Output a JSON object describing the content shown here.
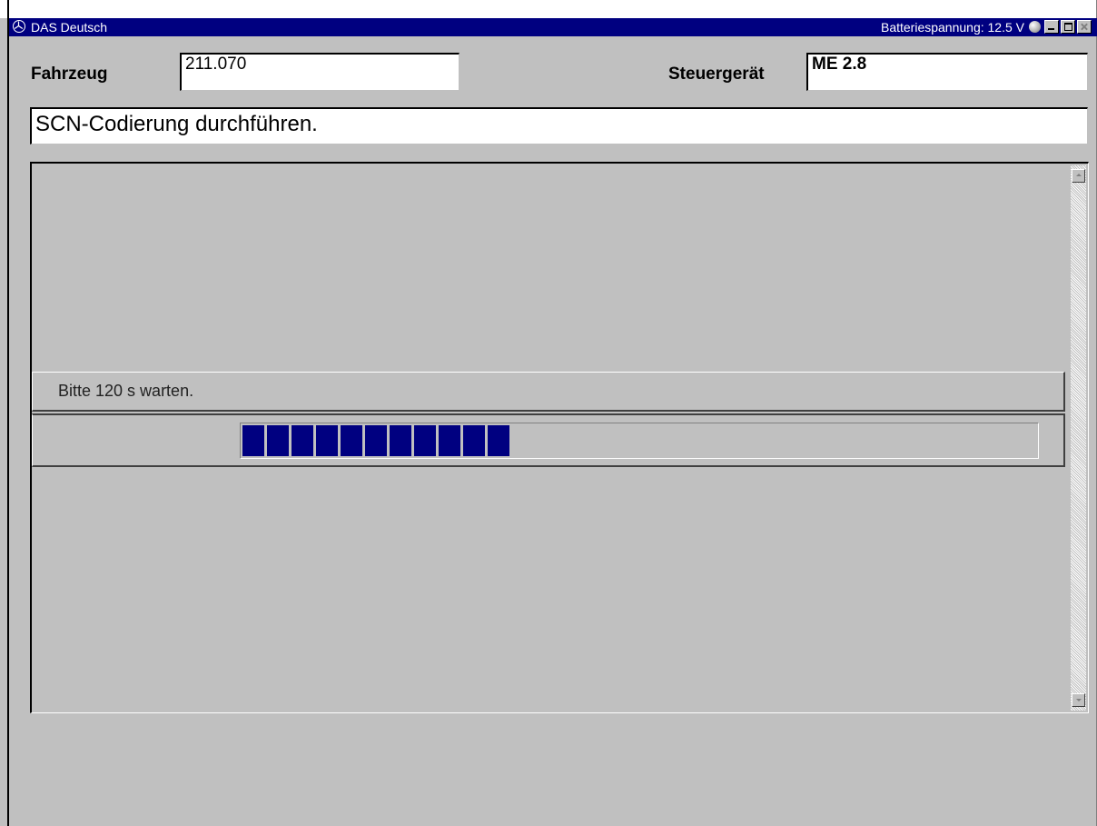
{
  "window": {
    "title": "DAS Deutsch",
    "battery_text": "Batteriespannung: 12.5 V",
    "buttons": [
      "minimize",
      "maximize",
      "close"
    ]
  },
  "header": {
    "vehicle_label": "Fahrzeug",
    "vehicle_value": "211.070",
    "ecu_label": "Steuergerät",
    "ecu_value": "ME 2.8"
  },
  "instruction": "SCN-Codierung durchführen.",
  "progress": {
    "message": "Bitte 120 s warten.",
    "filled_segments": 11,
    "total_segments": 32,
    "fraction": 0.34,
    "bar_color": "#000080"
  },
  "colors": {
    "title_bar": "#000080",
    "background": "#c0c0c0"
  },
  "icons": {
    "logo": "mercedes-star-icon",
    "status": "status-led-icon"
  }
}
